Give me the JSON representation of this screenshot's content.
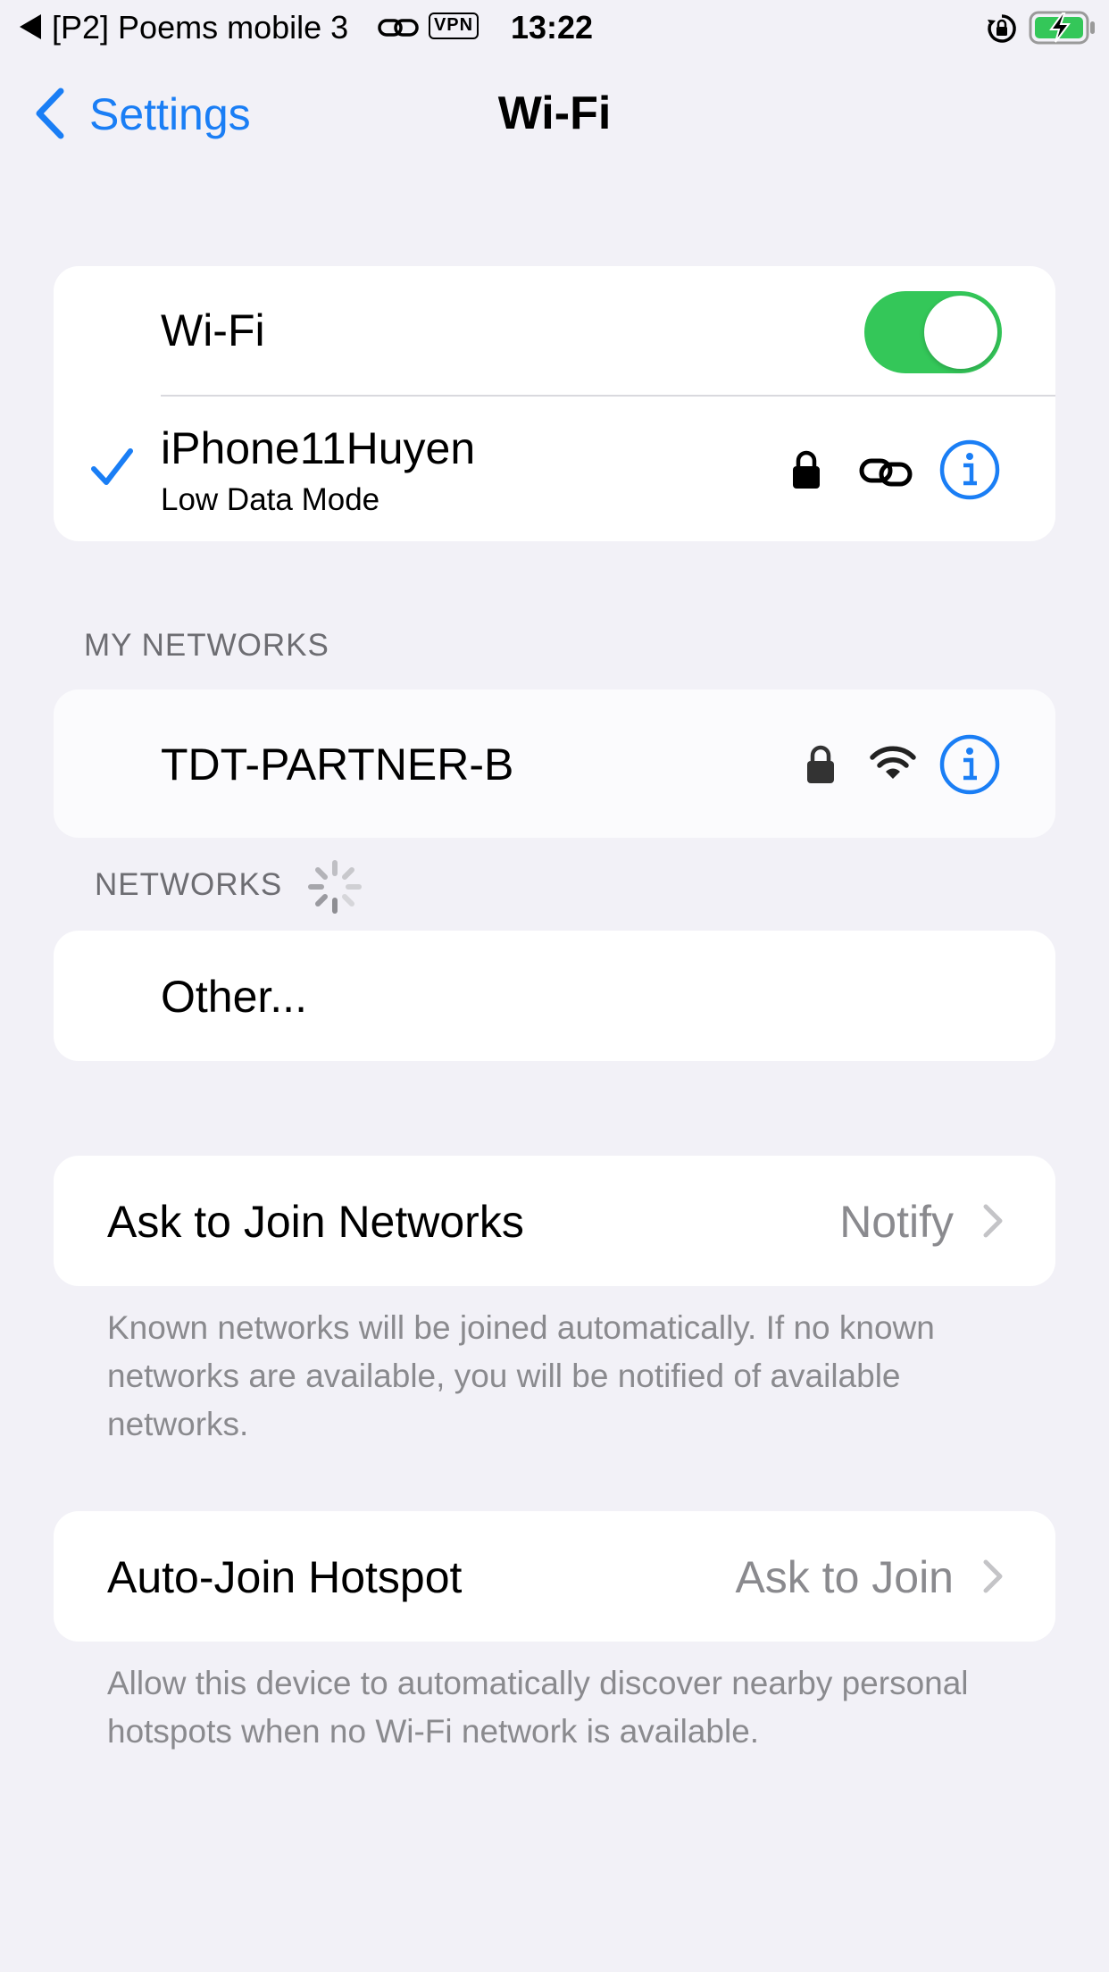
{
  "status_bar": {
    "back_app": "[P2] Poems mobile 3",
    "vpn": "VPN",
    "time": "13:22",
    "icons": [
      "back-triangle-icon",
      "link-icon",
      "vpn-badge",
      "rotation-lock-icon",
      "battery-charging-icon"
    ]
  },
  "nav": {
    "back_label": "Settings",
    "title": "Wi-Fi"
  },
  "wifi_card": {
    "toggle_label": "Wi-Fi",
    "toggle_on": true,
    "connected_network": "iPhone11Huyen",
    "connected_subtitle": "Low Data Mode"
  },
  "my_networks": {
    "header": "MY NETWORKS",
    "items": [
      {
        "name": "TDT-PARTNER-B"
      }
    ]
  },
  "networks": {
    "header": "NETWORKS",
    "other_label": "Other..."
  },
  "ask_to_join": {
    "label": "Ask to Join Networks",
    "value": "Notify",
    "footer": "Known networks will be joined automatically. If no known networks are available, you will be notified of available networks."
  },
  "auto_join": {
    "label": "Auto-Join Hotspot",
    "value": "Ask to Join",
    "footer": "Allow this device to automatically discover nearby personal hotspots when no Wi-Fi network is available."
  },
  "colors": {
    "accent": "#1a7ef5",
    "toggle_on": "#34c759",
    "background": "#f2f1f7",
    "secondary_text": "#8a8a8e"
  }
}
